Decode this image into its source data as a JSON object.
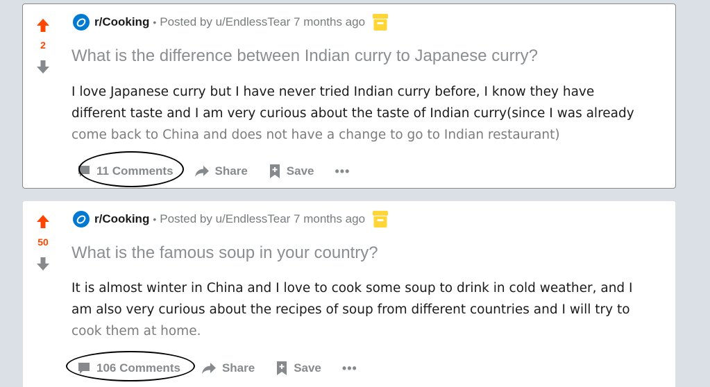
{
  "posts": [
    {
      "score": "2",
      "subreddit": "r/Cooking",
      "separator": "•",
      "posted_by": "Posted by u/EndlessTear 7 months ago",
      "title": "What is the difference between Indian curry to Japanese curry?",
      "body_lines": [
        "I love Japanese curry but I have never tried Indian curry before, I know they have",
        "different taste and I am very curious about the taste of Indian curry(since I was already",
        "come back to China and does not have a change to go to Indian restaurant)"
      ],
      "comments": "11 Comments",
      "share": "Share",
      "save": "Save",
      "more": "•••"
    },
    {
      "score": "50",
      "subreddit": "r/Cooking",
      "separator": "•",
      "posted_by": "Posted by u/EndlessTear 7 months ago",
      "title": "What is the famous soup in your country?",
      "body_lines": [
        "It is almost winter in China and I love to cook some soup to drink in cold weather, and I",
        "am also very curious about the recipes of soup from different countries and I will try to",
        "cook them at home."
      ],
      "comments": "106 Comments",
      "share": "Share",
      "save": "Save",
      "more": "•••"
    }
  ],
  "colors": {
    "upvote": "#ff4500",
    "muted": "#878a8c",
    "subreddit_icon": "#0079d3",
    "award": "#ffd635"
  },
  "icons": [
    "upvote-arrow-icon",
    "downvote-arrow-icon",
    "subreddit-icon",
    "award-icon",
    "comment-icon",
    "share-icon",
    "save-icon",
    "more-icon"
  ]
}
